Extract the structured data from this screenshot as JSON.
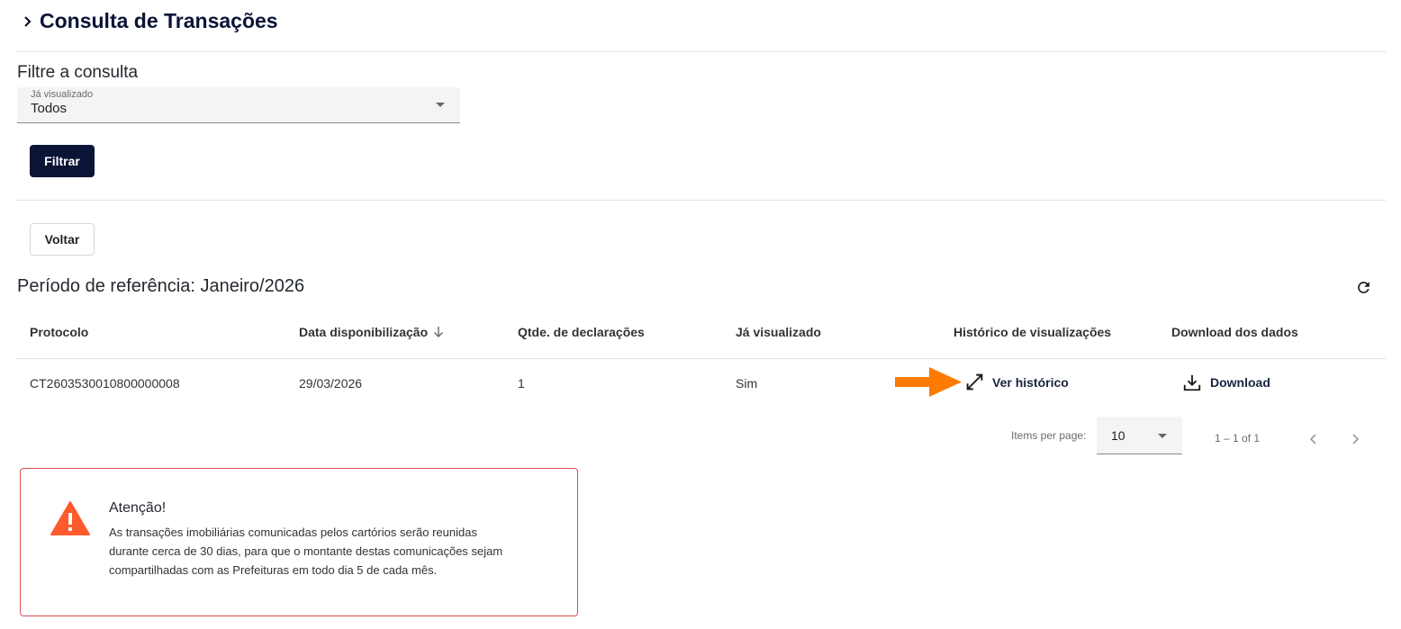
{
  "header": {
    "title": "Consulta de Transações"
  },
  "filter": {
    "heading": "Filtre a consulta",
    "select_label": "Já visualizado",
    "select_value": "Todos",
    "submit_label": "Filtrar"
  },
  "back_label": "Voltar",
  "period": {
    "heading": "Período de referência: Janeiro/2026"
  },
  "table": {
    "columns": [
      "Protocolo",
      "Data disponibilização",
      "Qtde. de declarações",
      "Já visualizado",
      "Histórico de visualizações",
      "Download dos dados"
    ],
    "rows": [
      {
        "protocolo": "CT2603530010800000008",
        "data": "29/03/2026",
        "qtde": "1",
        "visualizado": "Sim",
        "historico_label": "Ver histórico",
        "download_label": "Download"
      }
    ]
  },
  "pagination": {
    "items_per_page_label": "Items per page:",
    "page_size": "10",
    "range": "1 – 1 of 1"
  },
  "alert": {
    "title": "Atenção!",
    "lines": [
      "As transações imobiliárias comunicadas pelos cartórios serão reunidas",
      "durante cerca de 30 dias, para que o montante destas comunicações sejam",
      "compartilhadas com as Prefeituras em todo dia 5 de cada mês."
    ]
  },
  "colors": {
    "primary": "#0b1435",
    "annotation_arrow": "#ff7a00",
    "alert_border": "#d9534f",
    "alert_icon": "#ff5a2c"
  },
  "icons": [
    "chevron-right-icon",
    "caret-down-icon",
    "refresh-icon",
    "sort-arrow-down-icon",
    "expand-diagonal-icon",
    "download-icon",
    "chevron-left-icon",
    "warning-icon"
  ]
}
